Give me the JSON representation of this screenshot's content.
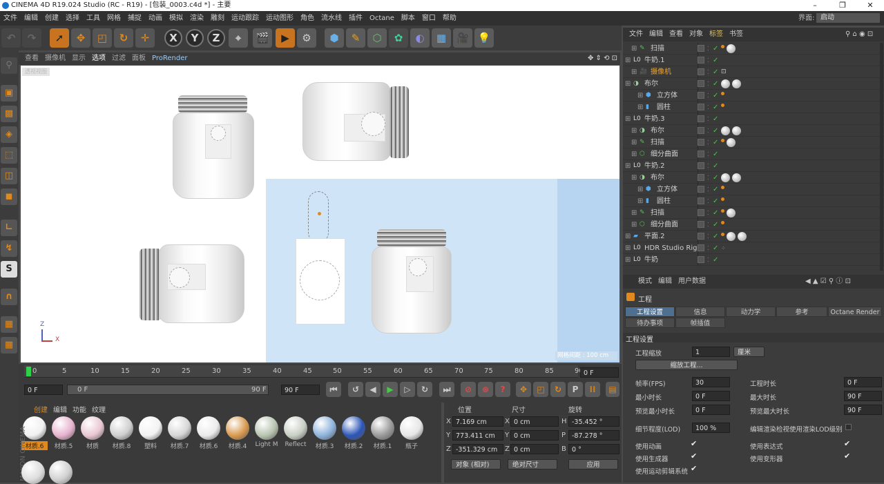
{
  "window": {
    "title": "CINEMA 4D R19.024 Studio (RC - R19) - [包装_0003.c4d *] - 主要"
  },
  "menu": {
    "items": [
      "文件",
      "编辑",
      "创建",
      "选择",
      "工具",
      "网格",
      "捕捉",
      "动画",
      "模拟",
      "渲染",
      "雕刻",
      "运动跟踪",
      "运动图形",
      "角色",
      "流水线",
      "插件",
      "Octane",
      "脚本",
      "窗口",
      "帮助"
    ],
    "layout_label": "界面:",
    "layout_value": "启动"
  },
  "toolbar": {
    "x_label": "X",
    "y_label": "Y",
    "z_label": "Z"
  },
  "viewport": {
    "menu": [
      "查看",
      "摄像机",
      "显示",
      "选项",
      "过滤",
      "面板",
      "ProRender"
    ],
    "selected_menu": "选项",
    "camera_label": "透视视图",
    "grid_label": "网格间距 : 100 cm",
    "axis_y": "Z",
    "axis_x": "X"
  },
  "timeline": {
    "ticks": [
      "0",
      "5",
      "10",
      "15",
      "20",
      "25",
      "30",
      "35",
      "40",
      "45",
      "50",
      "55",
      "60",
      "65",
      "70",
      "75",
      "80",
      "85",
      "90"
    ],
    "current_frame_field": "0 F",
    "start_field": "0 F",
    "slider_start": "0 F",
    "slider_end": "90 F",
    "end_field": "90 F"
  },
  "materials": {
    "menu": [
      "创建",
      "编辑",
      "功能",
      "纹理"
    ],
    "items": [
      {
        "label": "材质.6",
        "color": "#f0f0f0",
        "selected": true
      },
      {
        "label": "材质.5",
        "color": "#e7b3cf"
      },
      {
        "label": "材质",
        "color": "#e9c6d3"
      },
      {
        "label": "材质.8",
        "color": "#cfcfcf"
      },
      {
        "label": "塑料",
        "color": "#f2f2f2"
      },
      {
        "label": "材质.7",
        "color": "#d6d6d6"
      },
      {
        "label": "材质.6",
        "color": "#ebebeb"
      },
      {
        "label": "材质.4",
        "color": "#d99a4f"
      },
      {
        "label": "Light M",
        "color": "#b8c4b0"
      },
      {
        "label": "Reflect",
        "color": "#c9cfc4"
      },
      {
        "label": "材质.3",
        "color": "#8eb3dc"
      },
      {
        "label": "材质.2",
        "color": "#2c56b8"
      },
      {
        "label": "材质.1",
        "color": "#9a9a9a"
      },
      {
        "label": "瓶子",
        "color": "#e6e6e6"
      }
    ]
  },
  "coords": {
    "headers": [
      "位置",
      "尺寸",
      "旋转"
    ],
    "rows": [
      {
        "a": "X",
        "pos": "7.169 cm",
        "b": "X",
        "size": "0 cm",
        "c": "H",
        "rot": "-35.452 °"
      },
      {
        "a": "Y",
        "pos": "773.411 cm",
        "b": "Y",
        "size": "0 cm",
        "c": "P",
        "rot": "-87.278 °"
      },
      {
        "a": "Z",
        "pos": "-351.329 cm",
        "b": "Z",
        "size": "0 cm",
        "c": "B",
        "rot": "0 °"
      }
    ],
    "mode_object": "对象 (相对)",
    "mode_size": "绝对尺寸",
    "apply": "应用"
  },
  "object_manager": {
    "menu": [
      "文件",
      "编辑",
      "查看",
      "对象",
      "标签",
      "书签"
    ],
    "rows": [
      {
        "name": "扫描",
        "indent": 1,
        "icon": "sweep",
        "tags": "dot-ball"
      },
      {
        "name": "牛奶.1",
        "indent": 0,
        "icon": "null",
        "tags": ""
      },
      {
        "name": "摄像机",
        "indent": 1,
        "icon": "camera",
        "tags": "cam",
        "name_color": "#e6a43a"
      },
      {
        "name": "布尔",
        "indent": 0,
        "icon": "boole",
        "tags": "balls"
      },
      {
        "name": "立方体",
        "indent": 2,
        "icon": "cube",
        "tags": "dot"
      },
      {
        "name": "圆柱",
        "indent": 2,
        "icon": "cyl",
        "tags": "dot"
      },
      {
        "name": "牛奶.3",
        "indent": 0,
        "icon": "null",
        "tags": ""
      },
      {
        "name": "布尔",
        "indent": 1,
        "icon": "boole",
        "tags": "balls"
      },
      {
        "name": "扫描",
        "indent": 1,
        "icon": "sweep",
        "tags": "dot-ball"
      },
      {
        "name": "细分曲面",
        "indent": 1,
        "icon": "subd",
        "tags": ""
      },
      {
        "name": "牛奶.2",
        "indent": 0,
        "icon": "null",
        "tags": ""
      },
      {
        "name": "布尔",
        "indent": 1,
        "icon": "boole",
        "tags": "balls"
      },
      {
        "name": "立方体",
        "indent": 2,
        "icon": "cube",
        "tags": "dot"
      },
      {
        "name": "圆柱",
        "indent": 2,
        "icon": "cyl",
        "tags": "dot"
      },
      {
        "name": "扫描",
        "indent": 1,
        "icon": "sweep",
        "tags": "dot-ball"
      },
      {
        "name": "细分曲面",
        "indent": 1,
        "icon": "subd",
        "tags": "dot"
      },
      {
        "name": "平面.2",
        "indent": 0,
        "icon": "plane",
        "tags": "balls3"
      },
      {
        "name": "HDR Studio Rig",
        "indent": 0,
        "icon": "null",
        "tags": "dots"
      },
      {
        "name": "牛奶",
        "indent": 0,
        "icon": "null",
        "tags": ""
      }
    ]
  },
  "attributes": {
    "menu": [
      "模式",
      "编辑",
      "用户数据"
    ],
    "section": "工程",
    "tabs_row1": [
      "工程设置",
      "信息",
      "动力学",
      "参考",
      "Octane Render"
    ],
    "tabs_row2": [
      "待办事项",
      "帧插值"
    ],
    "group_title": "工程设置",
    "scale_label": "工程缩放",
    "scale_value": "1",
    "scale_unit": "厘米",
    "scale_button": "缩放工程...",
    "fps_label": "帧率(FPS)",
    "fps_value": "30",
    "proj_time_label": "工程时长",
    "proj_time_value": "0 F",
    "min_time_label": "最小时长",
    "min_time_value": "0 F",
    "max_time_label": "最大时长",
    "max_time_value": "90 F",
    "prev_min_label": "预览最小时长",
    "prev_min_value": "0 F",
    "prev_max_label": "预览最大时长",
    "prev_max_value": "90 F",
    "lod_label": "细节程度(LOD)",
    "lod_value": "100 %",
    "lod_render_label": "编辑渲染检视使用渲染LOD级别",
    "use_anim_label": "使用动画",
    "use_expr_label": "使用表达式",
    "use_gen_label": "使用生成器",
    "use_deform_label": "使用变形器",
    "use_motion_label": "使用运动剪辑系统"
  }
}
